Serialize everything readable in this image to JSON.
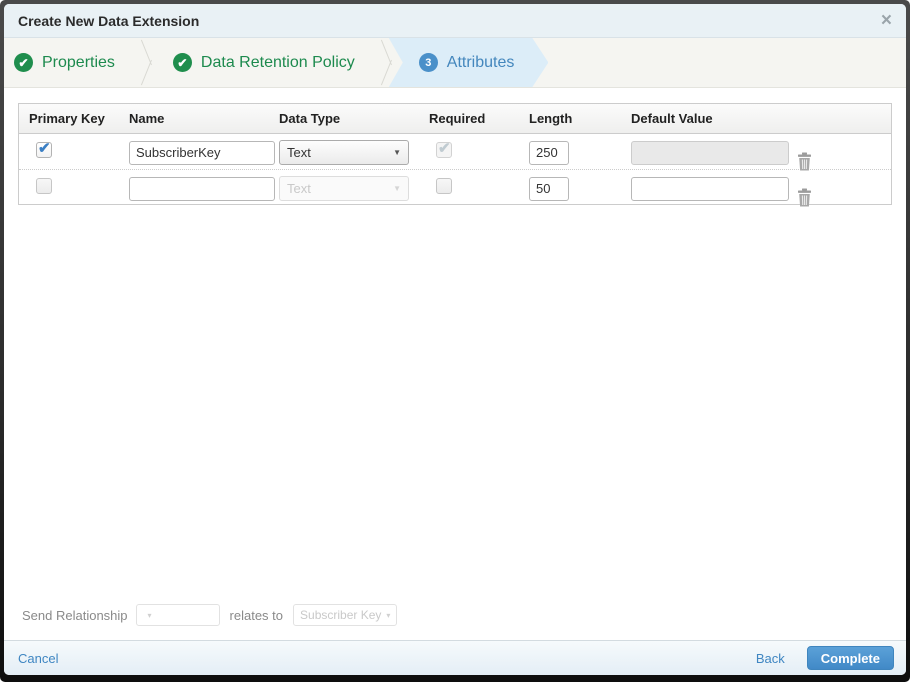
{
  "modal": {
    "title": "Create New Data Extension"
  },
  "icons": {
    "close_glyph": "×",
    "check_glyph": "✔",
    "caret_down": "▼",
    "caret_down_small": "▾"
  },
  "wizard": {
    "steps": [
      {
        "label": "Properties",
        "status": "complete"
      },
      {
        "label": "Data Retention Policy",
        "status": "complete"
      },
      {
        "label": "Attributes",
        "status": "active",
        "badge": "3"
      }
    ]
  },
  "table": {
    "columns": [
      "Primary Key",
      "Name",
      "Data Type",
      "Required",
      "Length",
      "Default Value"
    ],
    "rows": [
      {
        "primary_key_checked": true,
        "name": "SubscriberKey",
        "data_type": "Text",
        "required_checked": true,
        "required_disabled": true,
        "length": "250",
        "default_value": "",
        "default_disabled": true
      },
      {
        "primary_key_checked": false,
        "name": "",
        "data_type": "Text",
        "data_type_disabled": true,
        "required_checked": false,
        "length": "50",
        "default_value": "",
        "default_disabled": false
      }
    ]
  },
  "send_relationship": {
    "label": "Send Relationship",
    "relates_to": "relates to",
    "target_field": "Subscriber Key"
  },
  "footer": {
    "cancel": "Cancel",
    "back": "Back",
    "complete": "Complete"
  },
  "colors": {
    "accent_green": "#1f8e4d",
    "accent_blue": "#4a90c9",
    "link_blue": "#3f86c2",
    "active_step_bg": "#dcedf8"
  }
}
